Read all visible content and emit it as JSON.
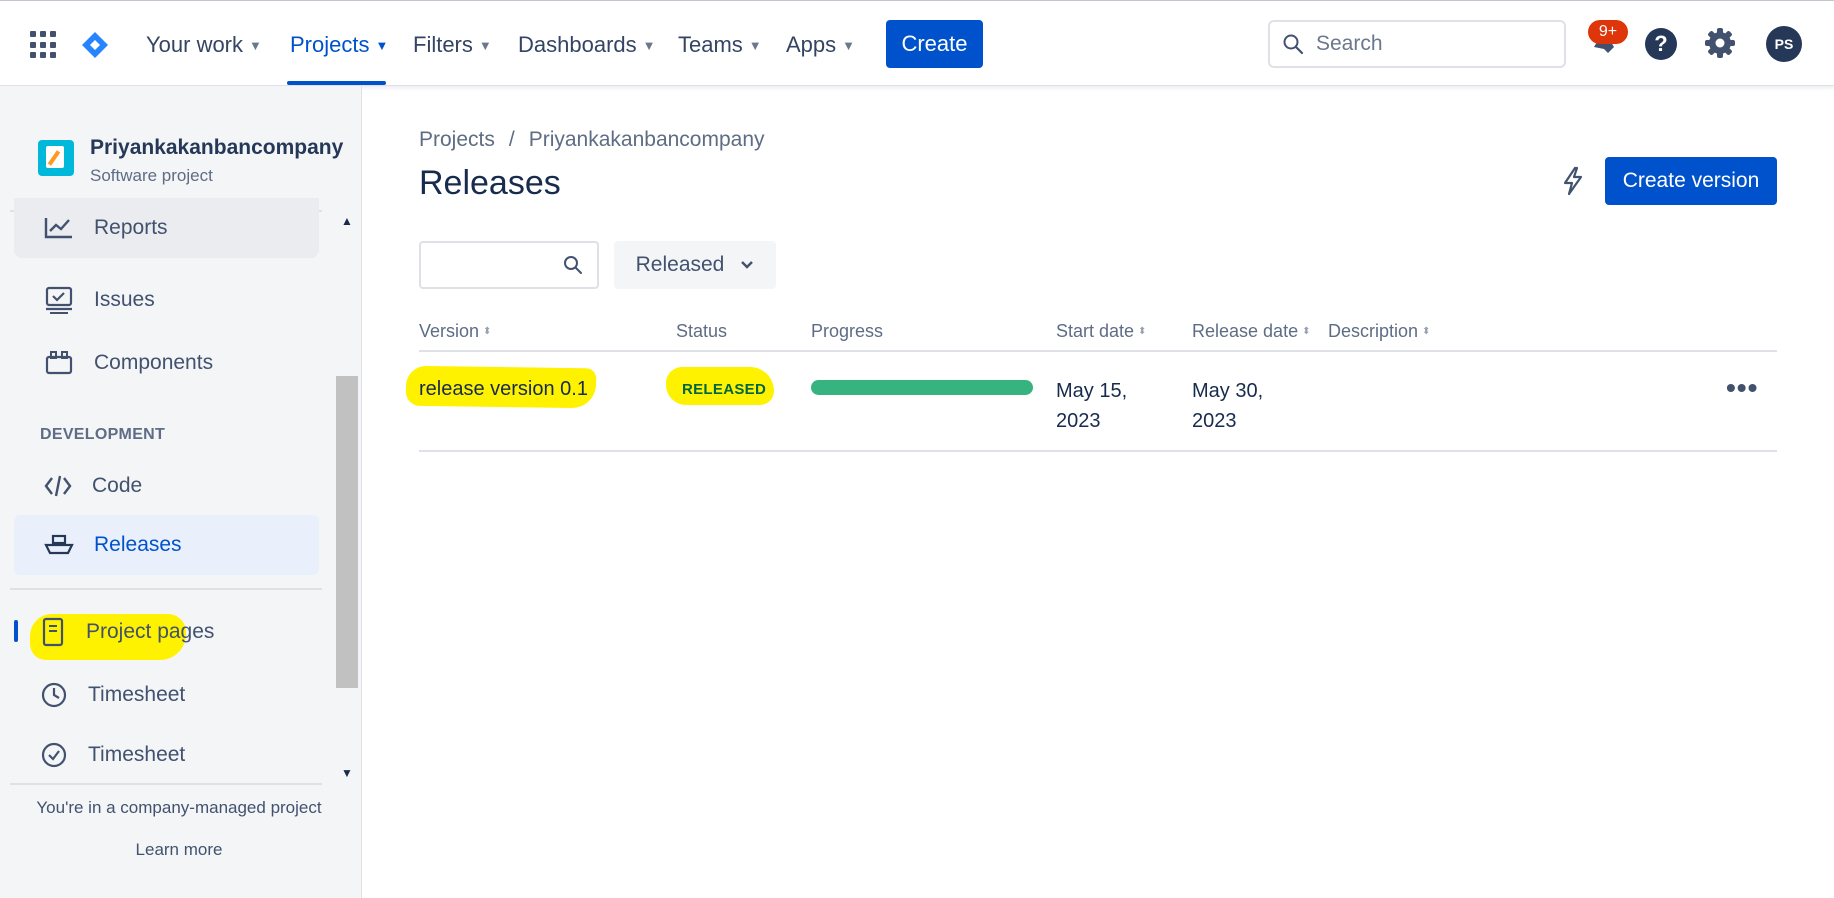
{
  "topnav": {
    "items": [
      {
        "label": "Your work"
      },
      {
        "label": "Projects"
      },
      {
        "label": "Filters"
      },
      {
        "label": "Dashboards"
      },
      {
        "label": "Teams"
      },
      {
        "label": "Apps"
      }
    ],
    "create_label": "Create",
    "search_placeholder": "Search",
    "notifications_badge": "9+",
    "help_glyph": "?",
    "avatar_initials": "PS",
    "active_item": "Projects",
    "accent_color": "#0052cc"
  },
  "sidebar": {
    "project_name": "Priyankakanbancompany",
    "project_type": "Software project",
    "items": [
      {
        "label": "Reports",
        "icon": "chart-line-icon"
      },
      {
        "label": "Issues",
        "icon": "issues-icon"
      },
      {
        "label": "Components",
        "icon": "components-icon"
      },
      {
        "label": "Code",
        "icon": "code-icon"
      },
      {
        "label": "Releases",
        "icon": "ship-icon"
      },
      {
        "label": "Project pages",
        "icon": "page-icon"
      },
      {
        "label": "Timesheet",
        "icon": "clock-icon"
      },
      {
        "label": "Timesheet",
        "icon": "check-circle-icon"
      }
    ],
    "section_development": "DEVELOPMENT",
    "footer_text": "You're in a company-managed project",
    "learn_more": "Learn more"
  },
  "main": {
    "breadcrumb": [
      "Projects",
      "Priyankakanbancompany"
    ],
    "breadcrumb_sep": "/",
    "title": "Releases",
    "create_version_label": "Create version",
    "status_filter": "Released",
    "columns": [
      "Version",
      "Status",
      "Progress",
      "Start date",
      "Release date",
      "Description"
    ],
    "rows": [
      {
        "version": "release version 0.1",
        "status": "RELEASED",
        "progress": 1.0,
        "start_date": "May 15, 2023",
        "release_date": "May 30, 2023",
        "description": ""
      }
    ],
    "more_glyph": "•••"
  }
}
